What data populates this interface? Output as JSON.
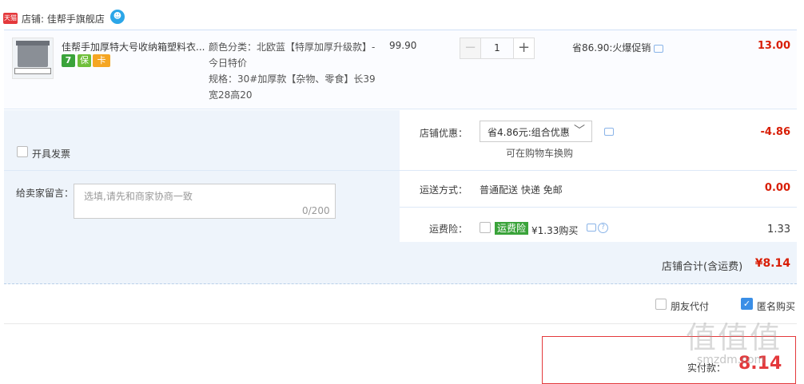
{
  "shop": {
    "badge": "天猫",
    "label": "店铺: 佳帮手旗舰店"
  },
  "item": {
    "title": "佳帮手加厚特大号收纳箱塑料衣...",
    "service_icons": [
      "7",
      "保",
      "卡"
    ],
    "sku_color": "颜色分类：北欧蓝【特厚加厚升级款】-今日特价",
    "sku_spec": "规格：30#加厚款【杂物、零食】长39宽28高20",
    "price": "99.90",
    "quantity": "1",
    "saving": "省86.90:火爆促销",
    "subtotal": "13.00"
  },
  "options": {
    "invoice_label": "开具发票",
    "memo_label": "给卖家留言：",
    "memo_placeholder": "选填,请先和商家协商一致",
    "memo_count": "0/200",
    "promo_label": "店铺优惠：",
    "promo_selected": "省4.86元:组合优惠",
    "promo_sub": "可在购物车换购",
    "promo_amount": "-4.86",
    "shipping_label": "运送方式：",
    "shipping_value": "普通配送 快递 免邮",
    "shipping_amount": "0.00",
    "insurance_label": "运费险：",
    "insurance_tag": "运费险",
    "insurance_price": "¥1.33购买",
    "insurance_amount": "1.33",
    "total_label": "店铺合计(含运费)",
    "total_value": "¥8.14"
  },
  "bottom": {
    "friend_pay": "朋友代付",
    "anonymous": "匿名购买",
    "pay_label": "实付款：",
    "pay_value": "8.14",
    "watermark": "值值值",
    "watermark_url": "smzdm.com"
  },
  "colors": {
    "accent": "#d81e06",
    "panel": "#eef4fb",
    "check": "#3a8ee6"
  }
}
